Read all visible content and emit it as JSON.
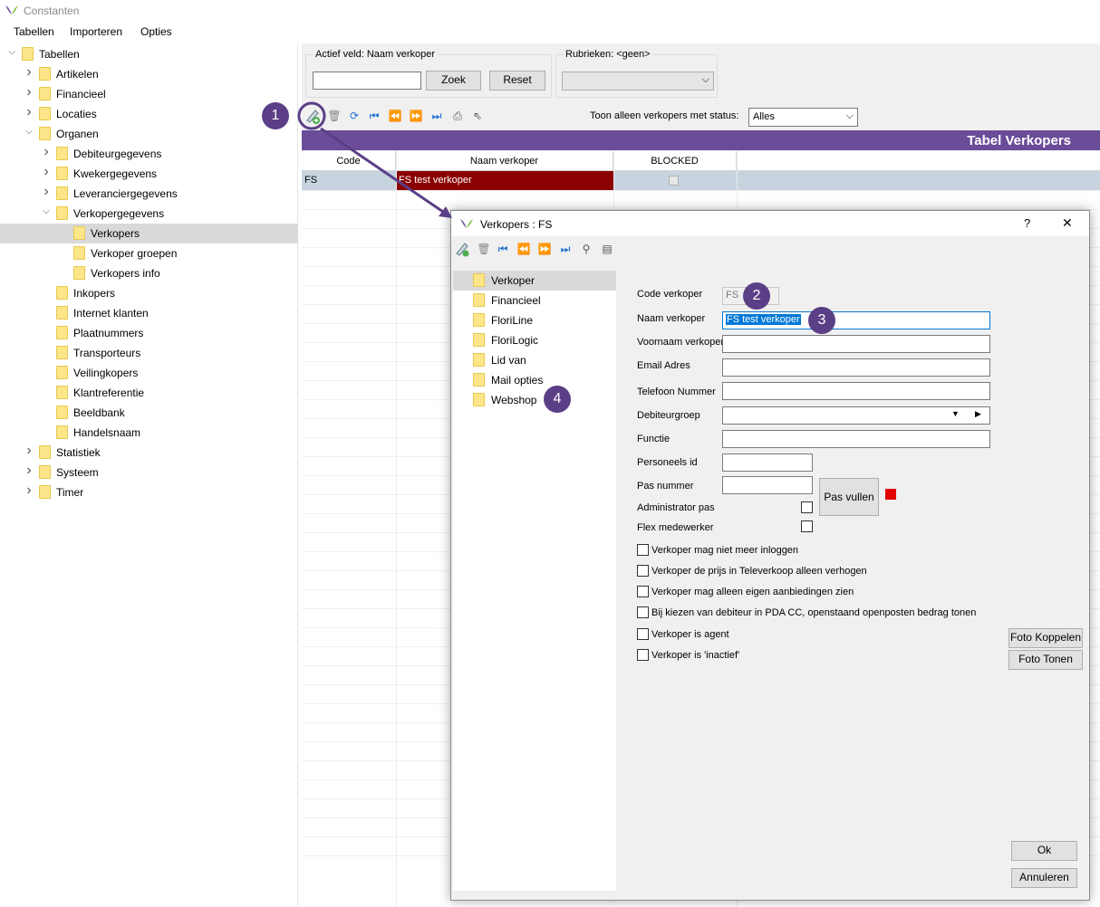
{
  "window": {
    "title": "Constanten"
  },
  "menu": [
    "Tabellen",
    "Importeren",
    "Opties"
  ],
  "tree": [
    {
      "label": "Tabellen",
      "level": 0,
      "state": "open"
    },
    {
      "label": "Artikelen",
      "level": 1,
      "state": "closed"
    },
    {
      "label": "Financieel",
      "level": 1,
      "state": "closed"
    },
    {
      "label": "Locaties",
      "level": 1,
      "state": "closed"
    },
    {
      "label": "Organen",
      "level": 1,
      "state": "open"
    },
    {
      "label": "Debiteurgegevens",
      "level": 2,
      "state": "closed"
    },
    {
      "label": "Kwekergegevens",
      "level": 2,
      "state": "closed"
    },
    {
      "label": "Leveranciergegevens",
      "level": 2,
      "state": "closed"
    },
    {
      "label": "Verkopergegevens",
      "level": 2,
      "state": "open"
    },
    {
      "label": "Verkopers",
      "level": 3,
      "state": "leaf",
      "selected": true
    },
    {
      "label": "Verkoper groepen",
      "level": 3,
      "state": "leaf"
    },
    {
      "label": "Verkopers info",
      "level": 3,
      "state": "leaf"
    },
    {
      "label": "Inkopers",
      "level": 2,
      "state": "leaf"
    },
    {
      "label": "Internet klanten",
      "level": 2,
      "state": "leaf"
    },
    {
      "label": "Plaatnummers",
      "level": 2,
      "state": "leaf"
    },
    {
      "label": "Transporteurs",
      "level": 2,
      "state": "leaf"
    },
    {
      "label": "Veilingkopers",
      "level": 2,
      "state": "leaf"
    },
    {
      "label": "Klantreferentie",
      "level": 2,
      "state": "leaf"
    },
    {
      "label": "Beeldbank",
      "level": 2,
      "state": "leaf"
    },
    {
      "label": "Handelsnaam",
      "level": 2,
      "state": "leaf"
    },
    {
      "label": "Statistiek",
      "level": 1,
      "state": "closed"
    },
    {
      "label": "Systeem",
      "level": 1,
      "state": "closed"
    },
    {
      "label": "Timer",
      "level": 1,
      "state": "closed"
    }
  ],
  "search": {
    "legend": "Actief veld: Naam verkoper",
    "value": "",
    "find_label": "Zoek",
    "reset_label": "Reset"
  },
  "rubrieken": {
    "legend": "Rubrieken: <geen>",
    "value": ""
  },
  "status_filter": {
    "label": "Toon alleen verkopers met status:",
    "value": "Alles"
  },
  "table": {
    "title": "Tabel Verkopers",
    "columns": [
      "Code",
      "Naam verkoper",
      "BLOCKED"
    ],
    "rows": [
      {
        "code": "FS",
        "name": "FS test verkoper",
        "blocked": false
      }
    ]
  },
  "dialog": {
    "title": "Verkopers : FS",
    "help": "?",
    "close": "✕",
    "nav": [
      "Verkoper",
      "Financieel",
      "FloriLine",
      "FloriLogic",
      "Lid van",
      "Mail opties",
      "Webshop"
    ],
    "fields": {
      "code_label": "Code verkoper",
      "code_value": "FS",
      "naam_label": "Naam verkoper",
      "naam_value": "FS test verkoper",
      "voornaam_label": "Voornaam verkoper",
      "voornaam_value": "",
      "email_label": "Email Adres",
      "email_value": "",
      "telefoon_label": "Telefoon Nummer",
      "telefoon_value": "",
      "debiteurgroep_label": "Debiteurgroep",
      "debiteurgroep_value": "",
      "functie_label": "Functie",
      "functie_value": "",
      "personeels_label": "Personeels id",
      "personeels_value": "",
      "pas_label": "Pas nummer",
      "pas_value": "",
      "pas_vullen": "Pas vullen",
      "admin_label": "Administrator pas",
      "flex_label": "Flex medewerker"
    },
    "checkboxes": [
      "Verkoper mag niet meer inloggen",
      "Verkoper de prijs in Televerkoop alleen verhogen",
      "Verkoper mag alleen eigen aanbiedingen zien",
      "Bij kiezen van debiteur in PDA CC, openstaand openposten bedrag tonen",
      "Verkoper is agent",
      "Verkoper is 'inactief'"
    ],
    "foto_koppelen": "Foto Koppelen",
    "foto_tonen": "Foto Tonen",
    "ok": "Ok",
    "annuleren": "Annuleren"
  },
  "callouts": [
    "1",
    "2",
    "3",
    "4"
  ],
  "colors": {
    "accent": "#6a4c99",
    "selected_cell": "#8b0000",
    "status_square": "#e00000",
    "badge": "#5b3f86"
  }
}
